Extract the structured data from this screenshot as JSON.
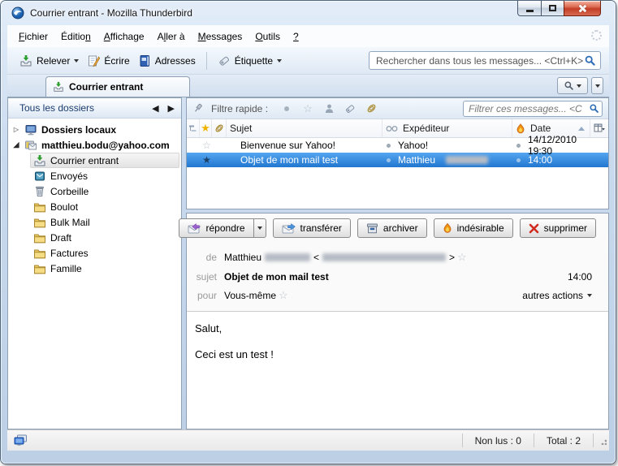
{
  "window": {
    "title": "Courrier entrant - Mozilla Thunderbird"
  },
  "menubar": {
    "items": [
      {
        "pre": "",
        "key": "F",
        "post": "ichier"
      },
      {
        "pre": "Éditio",
        "key": "n",
        "post": ""
      },
      {
        "pre": "",
        "key": "A",
        "post": "ffichage"
      },
      {
        "pre": "A",
        "key": "l",
        "post": "ler à"
      },
      {
        "pre": "",
        "key": "M",
        "post": "essages"
      },
      {
        "pre": "",
        "key": "O",
        "post": "utils"
      },
      {
        "pre": "",
        "key": "?",
        "post": ""
      }
    ]
  },
  "toolbar": {
    "check_mail_label": "Relever",
    "write_label": "Écrire",
    "address_book_label": "Adresses",
    "tag_label": "Étiquette",
    "search_placeholder": "Rechercher dans tous les messages... <Ctrl+K>"
  },
  "tabbar": {
    "active_tab": "Courrier entrant"
  },
  "folder_pane": {
    "header": "Tous les dossiers",
    "items": [
      {
        "icon": "local-folders",
        "label": "Dossiers locaux",
        "twisty": "collapsed",
        "bold": true
      },
      {
        "icon": "mail-account",
        "label": "matthieu.bodu@yahoo.com",
        "twisty": "expanded",
        "bold": true
      },
      {
        "icon": "inbox",
        "label": "Courrier entrant",
        "selected": true
      },
      {
        "icon": "sent",
        "label": "Envoyés"
      },
      {
        "icon": "trash",
        "label": "Corbeille"
      },
      {
        "icon": "folder",
        "label": "Boulot"
      },
      {
        "icon": "folder",
        "label": "Bulk Mail"
      },
      {
        "icon": "folder",
        "label": "Draft"
      },
      {
        "icon": "folder",
        "label": "Factures"
      },
      {
        "icon": "folder",
        "label": "Famille"
      }
    ]
  },
  "quick_filter": {
    "label": "Filtre rapide :",
    "buttons": [
      "unread",
      "starred",
      "contact",
      "tags",
      "attachment"
    ],
    "filter_placeholder": "Filtrer ces messages... <C"
  },
  "message_list": {
    "columns": {
      "subject": "Sujet",
      "sender": "Expéditeur",
      "date": "Date"
    },
    "rows": [
      {
        "subject": "Bienvenue sur Yahoo!",
        "sender": "Yahoo!",
        "date": "14/12/2010 19:30",
        "starred": false,
        "selected": false
      },
      {
        "subject": "Objet de mon mail test",
        "sender": "Matthieu",
        "sender_redacted": true,
        "date": "14:00",
        "starred": true,
        "selected": true
      }
    ]
  },
  "message": {
    "actions": {
      "reply": "répondre",
      "forward": "transférer",
      "archive": "archiver",
      "junk": "indésirable",
      "delete": "supprimer",
      "other_actions": "autres actions"
    },
    "headers": {
      "from_label": "de",
      "from_name": "Matthieu",
      "from_bracket_open": "<",
      "from_bracket_close": ">",
      "subject_label": "sujet",
      "subject": "Objet de mon mail test",
      "time": "14:00",
      "to_label": "pour",
      "to_value": "Vous-même"
    },
    "body_lines": [
      "Salut,",
      "Ceci est un test !"
    ]
  },
  "statusbar": {
    "unread": "Non lus : 0",
    "total": "Total : 2"
  },
  "icons": {
    "star_empty": "☆",
    "star_filled": "★",
    "twisty_collapsed": "▷",
    "twisty_expanded": "◢",
    "nav_back": "◀",
    "nav_forward": "▶"
  },
  "colors": {
    "selection_blue": "#2f7fd6",
    "frame_blue": "#cfdff0",
    "star_gold": "#f0b400",
    "flame_orange": "#f08c1a",
    "close_red": "#c33e26"
  }
}
